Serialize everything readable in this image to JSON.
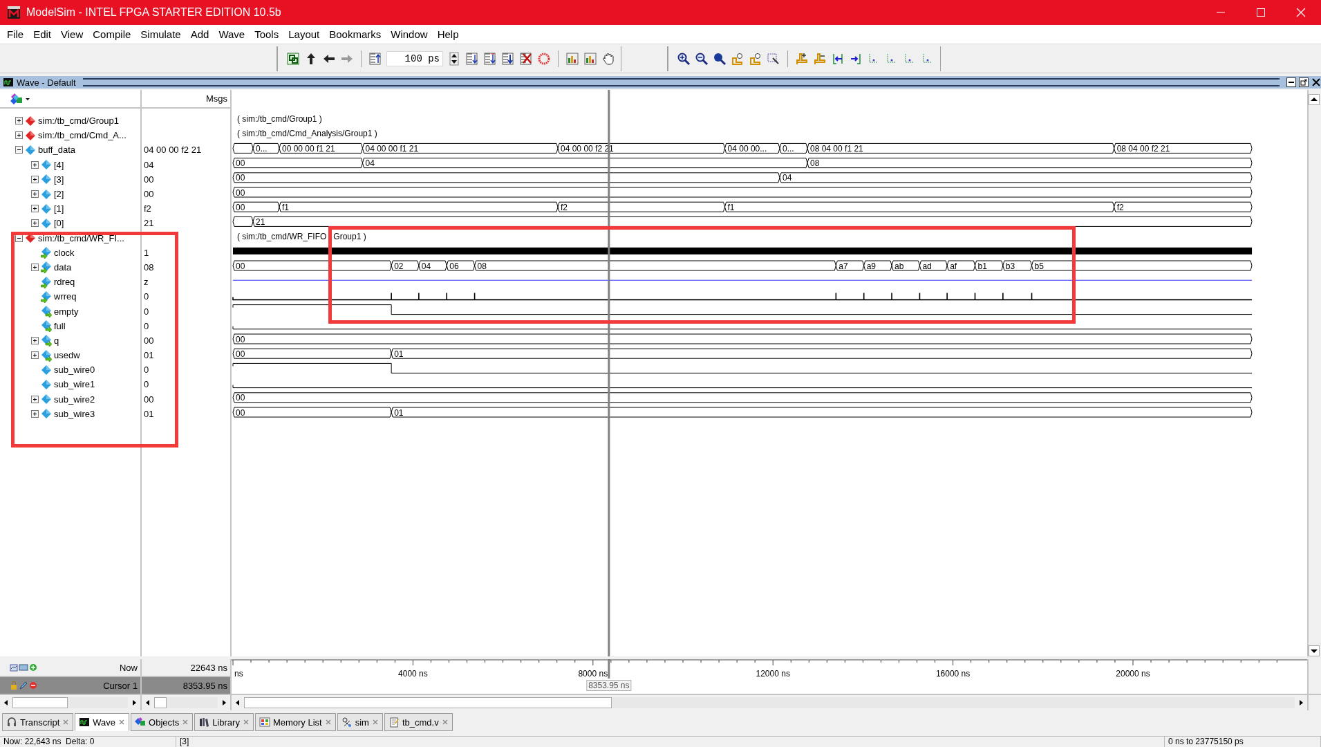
{
  "window": {
    "title": "ModelSim - INTEL FPGA STARTER EDITION 10.5b"
  },
  "menu": [
    "File",
    "Edit",
    "View",
    "Compile",
    "Simulate",
    "Add",
    "Wave",
    "Tools",
    "Layout",
    "Bookmarks",
    "Window",
    "Help"
  ],
  "toolbar": {
    "step_field": {
      "value": "100 ps"
    }
  },
  "wave_window": {
    "title": "Wave - Default",
    "msgs_header": "Msgs",
    "signals": [
      {
        "name": "sim:/tb_cmd/Group1",
        "kind": "group",
        "expanded": false,
        "wave": {
          "kind": "group",
          "label_parts": [
            "( sim:/tb_cmd/Group1 )"
          ]
        }
      },
      {
        "name": "sim:/tb_cmd/Cmd_A...",
        "kind": "group",
        "expanded": false,
        "wave": {
          "kind": "group",
          "label_parts": [
            "( sim:/tb_cmd/Cmd_Analysis/Group1 )"
          ]
        }
      },
      {
        "name": "buff_data",
        "kind": "signal",
        "expanded": true,
        "value": "04 00 00 f2 21",
        "wave": {
          "kind": "bus",
          "values": [
            "0...",
            "00 00 00 f1 21",
            "04 00 00 f1 21",
            "04 00 00 f2 21",
            "04 00 00...",
            "0...",
            "08 04 00 f1 21",
            "08 04 00 f2 21"
          ]
        },
        "children": [
          {
            "name": "[4]",
            "kind": "signal",
            "expanded": false,
            "value": "04",
            "wave": {
              "kind": "bus",
              "values": [
                "00",
                "04",
                "08"
              ]
            }
          },
          {
            "name": "[3]",
            "kind": "signal",
            "expanded": false,
            "value": "00",
            "wave": {
              "kind": "bus",
              "values": [
                "00",
                "04"
              ]
            }
          },
          {
            "name": "[2]",
            "kind": "signal",
            "expanded": false,
            "value": "00",
            "wave": {
              "kind": "bus",
              "values": [
                "00"
              ]
            }
          },
          {
            "name": "[1]",
            "kind": "signal",
            "expanded": false,
            "value": "f2",
            "wave": {
              "kind": "bus",
              "values": [
                "00",
                "f1",
                "f2",
                "f1",
                "f2"
              ]
            }
          },
          {
            "name": "[0]",
            "kind": "signal",
            "expanded": false,
            "value": "21",
            "wave": {
              "kind": "bus",
              "values": [
                "21"
              ]
            }
          }
        ]
      },
      {
        "name": "sim:/tb_cmd/WR_FI...",
        "kind": "group",
        "expanded": true,
        "wave": {
          "kind": "group",
          "label_parts": [
            "( sim:/tb_cmd/WR_FIFO",
            "Group1 )"
          ]
        },
        "children": [
          {
            "name": "clock",
            "kind": "input",
            "value": "1",
            "wave": {
              "kind": "clock"
            }
          },
          {
            "name": "data",
            "kind": "input",
            "expanded": false,
            "value": "08",
            "wave": {
              "kind": "bus",
              "values": [
                "00",
                "02",
                "04",
                "06",
                "08",
                "a7",
                "a9",
                "ab",
                "ad",
                "af",
                "b1",
                "b3",
                "b5"
              ]
            }
          },
          {
            "name": "rdreq",
            "kind": "input",
            "value": "z",
            "wave": {
              "kind": "z"
            }
          },
          {
            "name": "wrreq",
            "kind": "input",
            "value": "0",
            "wave": {
              "kind": "pulse"
            }
          },
          {
            "name": "empty",
            "kind": "output",
            "value": "0",
            "wave": {
              "kind": "bit"
            }
          },
          {
            "name": "full",
            "kind": "output",
            "value": "0",
            "wave": {
              "kind": "bit"
            }
          },
          {
            "name": "q",
            "kind": "output",
            "expanded": false,
            "value": "00",
            "wave": {
              "kind": "bus",
              "values": [
                "00"
              ]
            }
          },
          {
            "name": "usedw",
            "kind": "output",
            "expanded": false,
            "value": "01",
            "wave": {
              "kind": "bus",
              "values": [
                "00",
                "01"
              ]
            }
          },
          {
            "name": "sub_wire0",
            "kind": "signal",
            "value": "0",
            "wave": {
              "kind": "bit"
            }
          },
          {
            "name": "sub_wire1",
            "kind": "signal",
            "value": "0",
            "wave": {
              "kind": "bit"
            }
          },
          {
            "name": "sub_wire2",
            "kind": "signal",
            "expanded": false,
            "value": "00",
            "wave": {
              "kind": "bus",
              "values": [
                "00"
              ]
            }
          },
          {
            "name": "sub_wire3",
            "kind": "signal",
            "expanded": false,
            "value": "01",
            "wave": {
              "kind": "bus",
              "values": [
                "00",
                "01"
              ]
            }
          }
        ]
      }
    ],
    "axis_labels": [
      "ns",
      "4000 ns",
      "8000 ns",
      "12000 ns",
      "16000 ns",
      "20000 ns"
    ],
    "cursor_readout": "8353.95 ns",
    "now_row": {
      "label": "Now",
      "value": "22643 ns"
    },
    "cursor_row": {
      "label": "Cursor 1",
      "value": "8353.95 ns"
    }
  },
  "tabs": [
    {
      "label": "Transcript",
      "selected": false
    },
    {
      "label": "Wave",
      "selected": true
    },
    {
      "label": "Objects",
      "selected": false
    },
    {
      "label": "Library",
      "selected": false
    },
    {
      "label": "Memory List",
      "selected": false
    },
    {
      "label": "sim",
      "selected": false
    },
    {
      "label": "tb_cmd.v",
      "selected": false
    }
  ],
  "status_bar": [
    "Now: 22,643 ns  Delta: 0",
    "[3]",
    "0 ns to 23775150 ps"
  ]
}
